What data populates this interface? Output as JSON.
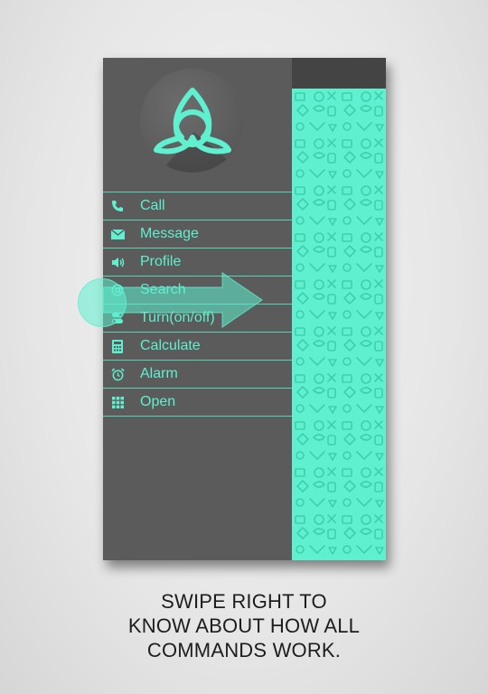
{
  "menu": {
    "items": [
      {
        "label": "Call",
        "icon": "phone-icon"
      },
      {
        "label": "Message",
        "icon": "envelope-icon"
      },
      {
        "label": "Profile",
        "icon": "speaker-icon"
      },
      {
        "label": "Search",
        "icon": "at-sign-icon"
      },
      {
        "label": "Turn(on/off)",
        "icon": "toggle-icon"
      },
      {
        "label": "Calculate",
        "icon": "calculator-icon"
      },
      {
        "label": "Alarm",
        "icon": "alarm-clock-icon"
      },
      {
        "label": "Open",
        "icon": "grid-icon"
      }
    ]
  },
  "logo": {
    "icon": "triquetra-icon"
  },
  "instruction": {
    "lines": [
      "SWIPE RIGHT TO",
      "KNOW ABOUT HOW ALL",
      "COMMANDS WORK."
    ]
  },
  "colors": {
    "accent": "#5ff0d0",
    "drawer_bg": "#5b5b5b",
    "topbar_bg": "#444444",
    "page_bg": "#e8e8e8"
  }
}
